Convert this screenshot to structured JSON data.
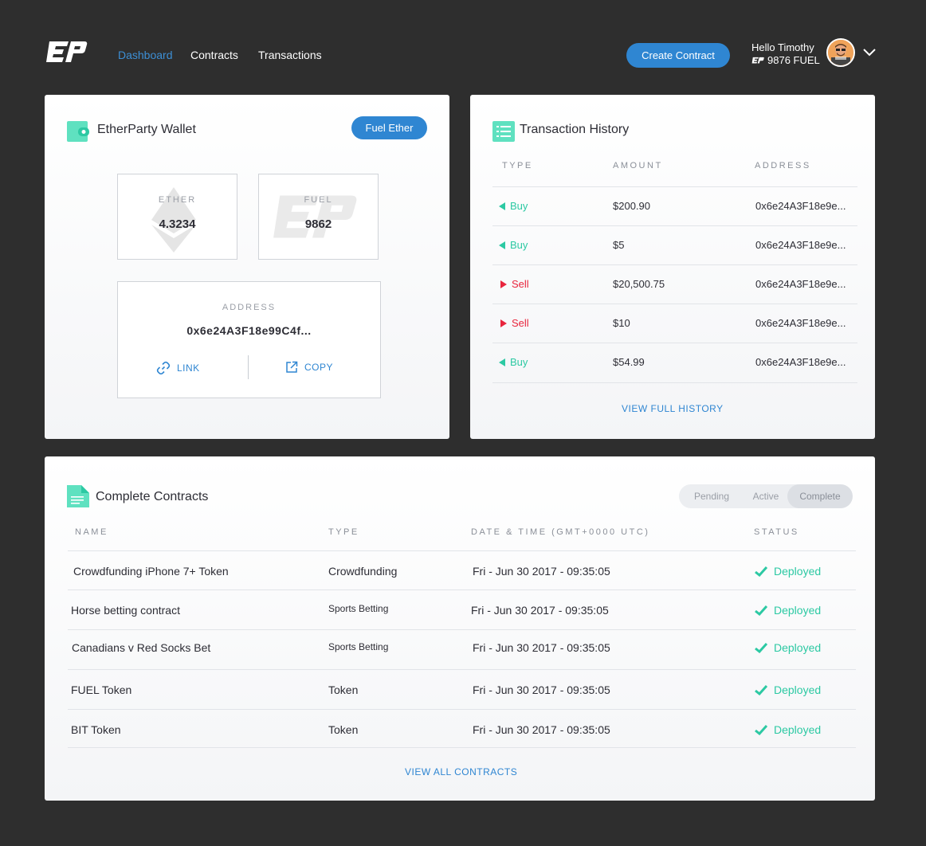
{
  "nav": {
    "links": [
      "Dashboard",
      "Contracts",
      "Transactions"
    ],
    "create_label": "Create Contract",
    "greeting": "Hello Timothy",
    "fuel": "9876 FUEL"
  },
  "wallet": {
    "title": "EtherParty Wallet",
    "fuel_button": "Fuel Ether",
    "ether_label": "ETHER",
    "ether_value": "4.3234",
    "fuel_label": "FUEL",
    "fuel_value": "9862",
    "address_label": "ADDRESS",
    "address_value": "0x6e24A3F18e99C4f...",
    "link_label": "LINK",
    "copy_label": "COPY"
  },
  "history": {
    "title": "Transaction History",
    "headers": [
      "TYPE",
      "AMOUNT",
      "ADDRESS"
    ],
    "rows": [
      {
        "type": "Buy",
        "amount": "$200.90",
        "address": "0x6e24A3F18e9e..."
      },
      {
        "type": "Buy",
        "amount": "$5",
        "address": "0x6e24A3F18e9e..."
      },
      {
        "type": "Sell",
        "amount": "$20,500.75",
        "address": "0x6e24A3F18e9e..."
      },
      {
        "type": "Sell",
        "amount": "$10",
        "address": "0x6e24A3F18e9e..."
      },
      {
        "type": "Buy",
        "amount": "$54.99",
        "address": "0x6e24A3F18e9e..."
      }
    ],
    "view_label": "VIEW FULL HISTORY"
  },
  "contracts": {
    "title": "Complete Contracts",
    "tabs": [
      "Pending",
      "Active",
      "Complete"
    ],
    "headers": [
      "NAME",
      "TYPE",
      "DATE & TIME (GMT+0000 UTC)",
      "STATUS"
    ],
    "rows": [
      {
        "name": "Crowdfunding iPhone 7+ Token",
        "type": "Crowdfunding",
        "date": "Fri - Jun 30 2017 - 09:35:05",
        "status": "Deployed"
      },
      {
        "name": "Horse betting contract",
        "type": "Sports Betting",
        "date": "Fri - Jun 30 2017 - 09:35:05",
        "status": "Deployed"
      },
      {
        "name": "Canadians v Red Socks Bet",
        "type": "Sports Betting",
        "date": "Fri - Jun 30 2017 - 09:35:05",
        "status": "Deployed"
      },
      {
        "name": "FUEL Token",
        "type": "Token",
        "date": "Fri - Jun 30 2017 - 09:35:05",
        "status": "Deployed"
      },
      {
        "name": "BIT Token",
        "type": "Token",
        "date": "Fri - Jun 30 2017 - 09:35:05",
        "status": "Deployed"
      }
    ],
    "view_label": "VIEW ALL CONTRACTS"
  },
  "colors": {
    "accent": "#2f86d2",
    "buy": "#2cc9a3",
    "sell": "#e8253d",
    "background": "#2e2e2e"
  }
}
